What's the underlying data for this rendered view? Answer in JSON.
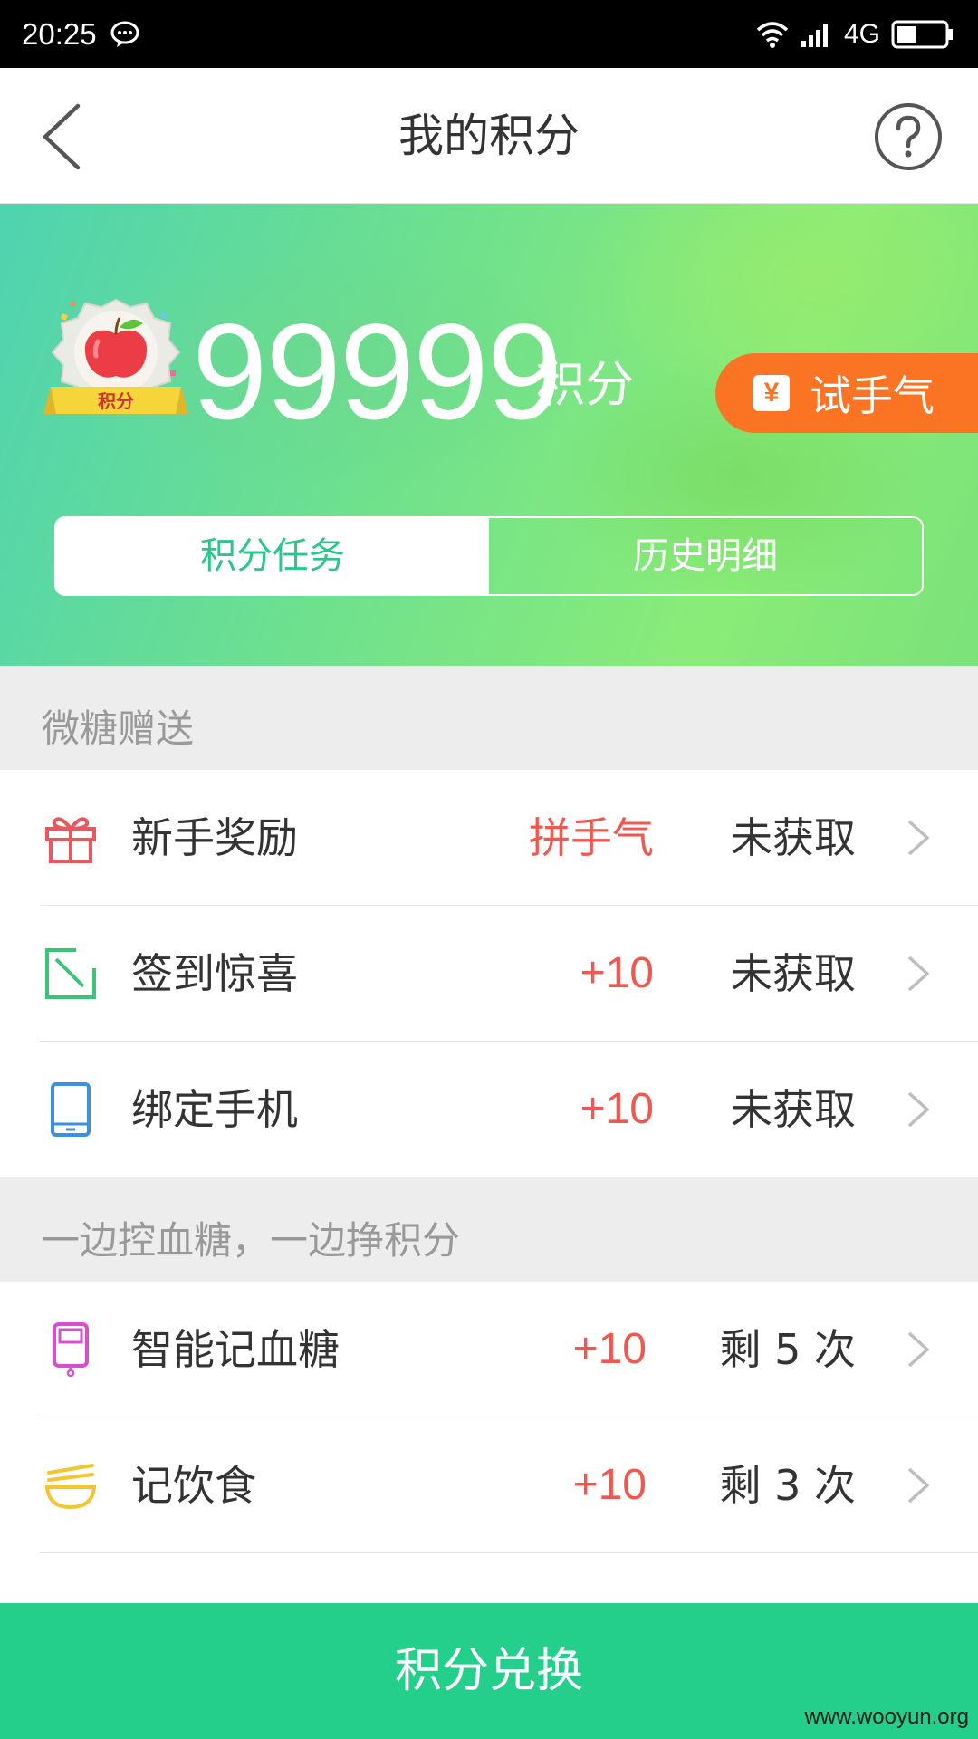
{
  "status_bar": {
    "time": "20:25",
    "network": "4G"
  },
  "nav": {
    "title": "我的积分"
  },
  "hero": {
    "badge_text": "积分",
    "points": "99999",
    "points_unit": "积分",
    "try_luck_label": "试手气",
    "tabs": [
      {
        "label": "积分任务",
        "active": true
      },
      {
        "label": "历史明细",
        "active": false
      }
    ]
  },
  "sections": [
    {
      "title": "微糖赠送",
      "items": [
        {
          "icon": "gift-icon",
          "label": "新手奖励",
          "points": "拼手气",
          "status": "未获取",
          "color": "#e8585f"
        },
        {
          "icon": "checkin-icon",
          "label": "签到惊喜",
          "points": "+10",
          "status": "未获取",
          "color": "#3ec27a"
        },
        {
          "icon": "phone-icon",
          "label": "绑定手机",
          "points": "+10",
          "status": "未获取",
          "color": "#3d8fe0"
        }
      ]
    },
    {
      "title": "一边控血糖，一边挣积分",
      "items": [
        {
          "icon": "glucose-meter-icon",
          "label": "智能记血糖",
          "points": "+10",
          "status": "剩 5 次",
          "color": "#d94fc9"
        },
        {
          "icon": "food-bowl-icon",
          "label": "记饮食",
          "points": "+10",
          "status": "剩 3 次",
          "color": "#f3c531"
        }
      ]
    }
  ],
  "bottom_button": {
    "label": "积分兑换"
  },
  "watermark": "www.wooyun.org",
  "colors": {
    "accent_green": "#24cf8c",
    "orange": "#fb7424",
    "red": "#f0584f"
  }
}
